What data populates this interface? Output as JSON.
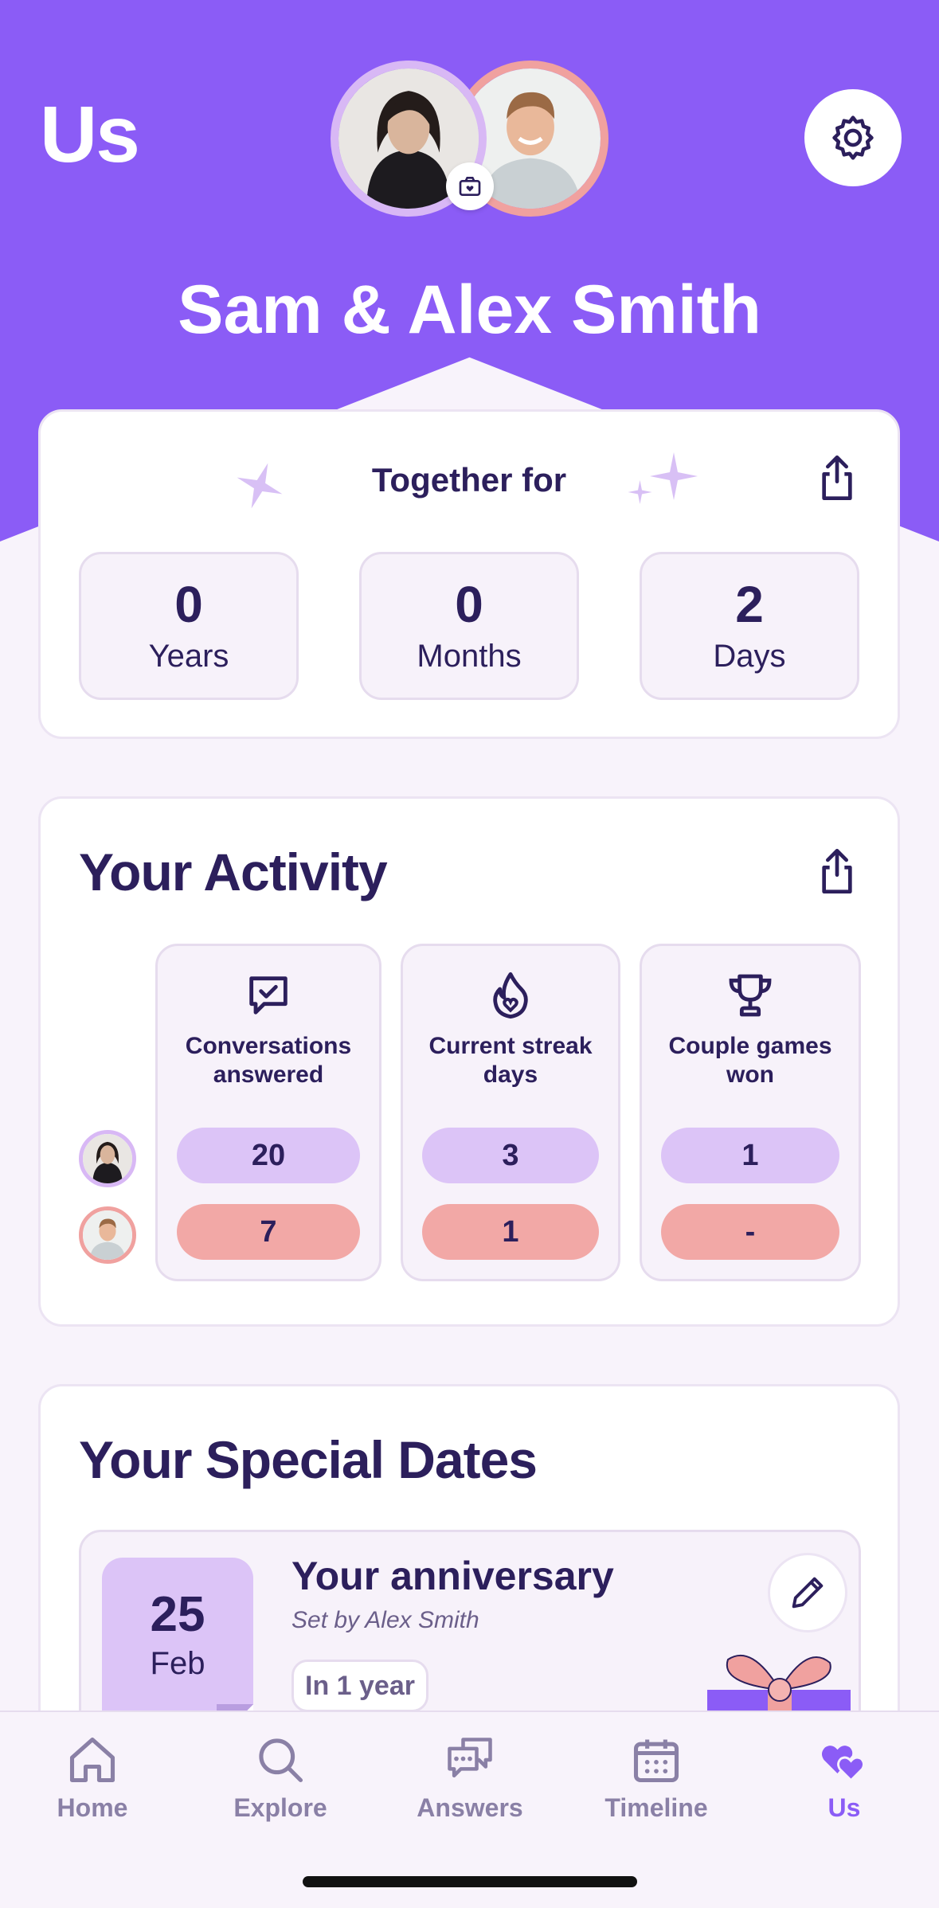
{
  "header": {
    "title": "Us",
    "couple_name": "Sam & Alex Smith"
  },
  "together": {
    "title": "Together for",
    "stats": [
      {
        "value": "0",
        "label": "Years"
      },
      {
        "value": "0",
        "label": "Months"
      },
      {
        "value": "2",
        "label": "Days"
      }
    ]
  },
  "activity": {
    "title": "Your Activity",
    "columns": [
      {
        "label": "Conversations answered",
        "icon": "chat-check-icon",
        "partner_a": "20",
        "partner_b": "7"
      },
      {
        "label": "Current streak days",
        "icon": "flame-heart-icon",
        "partner_a": "3",
        "partner_b": "1"
      },
      {
        "label": "Couple games won",
        "icon": "trophy-icon",
        "partner_a": "1",
        "partner_b": "-"
      }
    ]
  },
  "special_dates": {
    "title": "Your Special Dates",
    "items": [
      {
        "day": "25",
        "month": "Feb",
        "title": "Your anniversary",
        "subtitle": "Set by Alex Smith",
        "countdown": "In 1 year"
      }
    ]
  },
  "tabbar": {
    "items": [
      {
        "label": "Home",
        "icon": "home-icon",
        "active": false
      },
      {
        "label": "Explore",
        "icon": "search-icon",
        "active": false
      },
      {
        "label": "Answers",
        "icon": "chat-bubbles-icon",
        "active": false
      },
      {
        "label": "Timeline",
        "icon": "calendar-icon",
        "active": false
      },
      {
        "label": "Us",
        "icon": "hearts-icon",
        "active": true
      }
    ]
  },
  "colors": {
    "brand_purple": "#8b5cf6",
    "partner_a": "#dcc4f7",
    "partner_b": "#f2a8a6",
    "ink": "#2c1f5c"
  }
}
